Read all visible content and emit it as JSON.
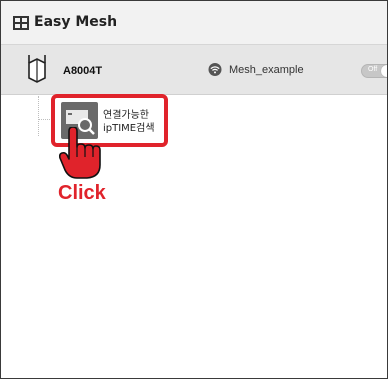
{
  "window": {
    "title": "Easy Mesh"
  },
  "device": {
    "model": "A8004T",
    "ssid": "Mesh_example",
    "toggle_label": "Off"
  },
  "search_node": {
    "label_line1": "연결가능한",
    "label_line2": "ipTIME검색"
  },
  "annotation": {
    "click_text": "Click",
    "color": "#e0232b"
  },
  "icons": {
    "title": "mesh-app-icon",
    "router": "router-icon",
    "wifi": "wifi-icon",
    "search": "device-search-icon",
    "hand": "pointing-hand-icon"
  }
}
